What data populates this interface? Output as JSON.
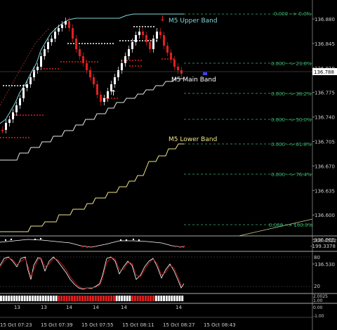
{
  "price_axis": {
    "ticks": [
      "136.880",
      "136.845",
      "136.810",
      "136.775",
      "136.740",
      "136.705",
      "136.670",
      "136.635",
      "136.600",
      "136.565",
      "136.530"
    ],
    "current_price": "136.788"
  },
  "fib_levels": [
    "0.000 --> 0.0%",
    "0.000 --> 23.6%",
    "0.000 --> 38.2%",
    "0.000 --> 50.0%",
    "0.000 --> 61.8%",
    "0.000 --> 76.4%",
    "0.000 --> 100.0%"
  ],
  "band_labels": {
    "upper": "M5 Upper Band",
    "main": "M5 Main Band",
    "lower": "M5 Lower Band"
  },
  "indicator1": {
    "max": "208.4522",
    "min": "-199.3378"
  },
  "indicator2": {
    "top": "80",
    "bottom": "20"
  },
  "indicator3": {
    "labels": [
      "2.0025",
      "1.00",
      "0.00",
      "-1.00"
    ]
  },
  "time_axis": {
    "labels": [
      "15 Oct 07:23",
      "15 Oct 07:39",
      "15 Oct 07:55",
      "15 Oct 08:11",
      "15 Oct 08:27",
      "15 Oct 08:43"
    ],
    "bar_labels": [
      "13",
      "13",
      "14",
      "14",
      "14",
      "14"
    ]
  },
  "colors": {
    "background": "#000000",
    "upper_band": "#7fd7d7",
    "main_band": "#ffffff",
    "lower_band": "#f0e68c",
    "fib": "#3cb371",
    "bear": "#e02020",
    "bull": "#ffffff",
    "signal": "#ff2020"
  }
}
